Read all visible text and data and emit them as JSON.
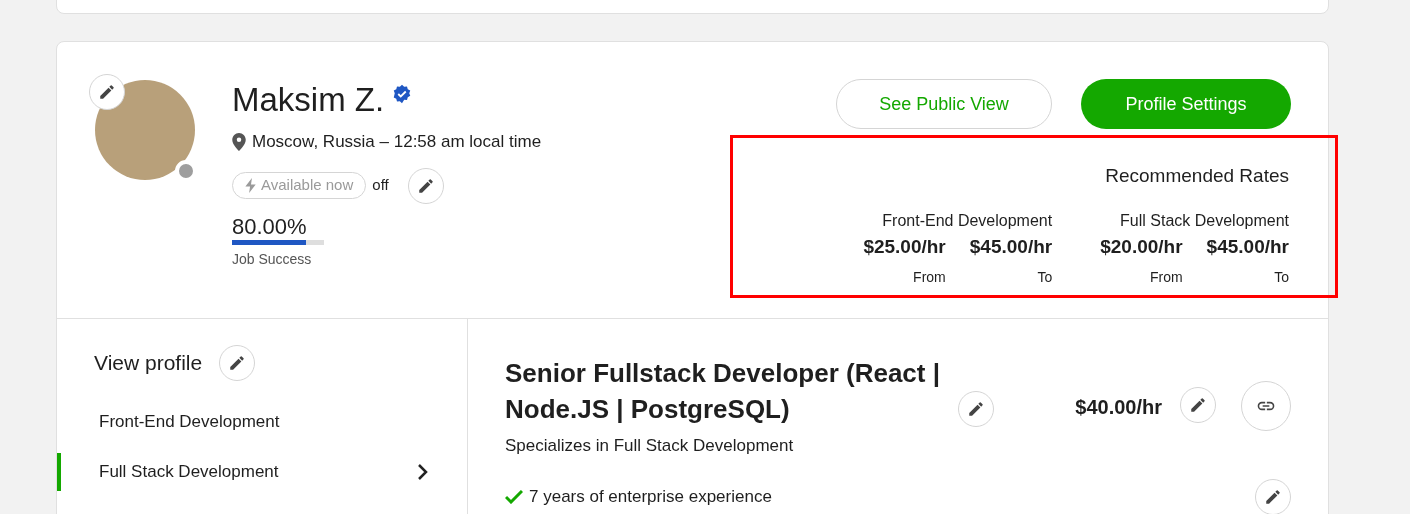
{
  "profile": {
    "name": "Maksim Z.",
    "verified": true,
    "online": false,
    "location": "Moscow, Russia – 12:58 am local time",
    "availability": {
      "label": "Available now",
      "on": false,
      "status": "off"
    },
    "job_success": {
      "value": "80.00%",
      "level": 0.8,
      "label": "Job Success"
    }
  },
  "buttons": [
    {
      "label": "See Public View",
      "kind": "secondary"
    },
    {
      "label": "Profile Settings",
      "kind": "primary"
    }
  ],
  "recommended_rates": {
    "title": "Recommended Rates",
    "highlighted": true,
    "groups": [
      {
        "name": "Front-End Development",
        "from": "$25.00/hr",
        "from_label": "From",
        "to": "$45.00/hr",
        "to_label": "To"
      },
      {
        "name": "Full Stack Development",
        "from": "$20.00/hr",
        "from_label": "From",
        "to": "$45.00/hr",
        "to_label": "To"
      }
    ]
  },
  "sidebar": {
    "title": "View profile",
    "items": [
      {
        "label": "Front-End Development",
        "selected": false
      },
      {
        "label": "Full Stack Development",
        "selected": true
      }
    ]
  },
  "specialized_profile": {
    "title": "Senior Fullstack Developer (React | Node.JS | PostgreSQL)",
    "rate": "$40.00/hr",
    "subtitle": "Specializes in Full Stack Development",
    "highlights": [
      {
        "text": "7 years of enterprise experience"
      }
    ]
  }
}
